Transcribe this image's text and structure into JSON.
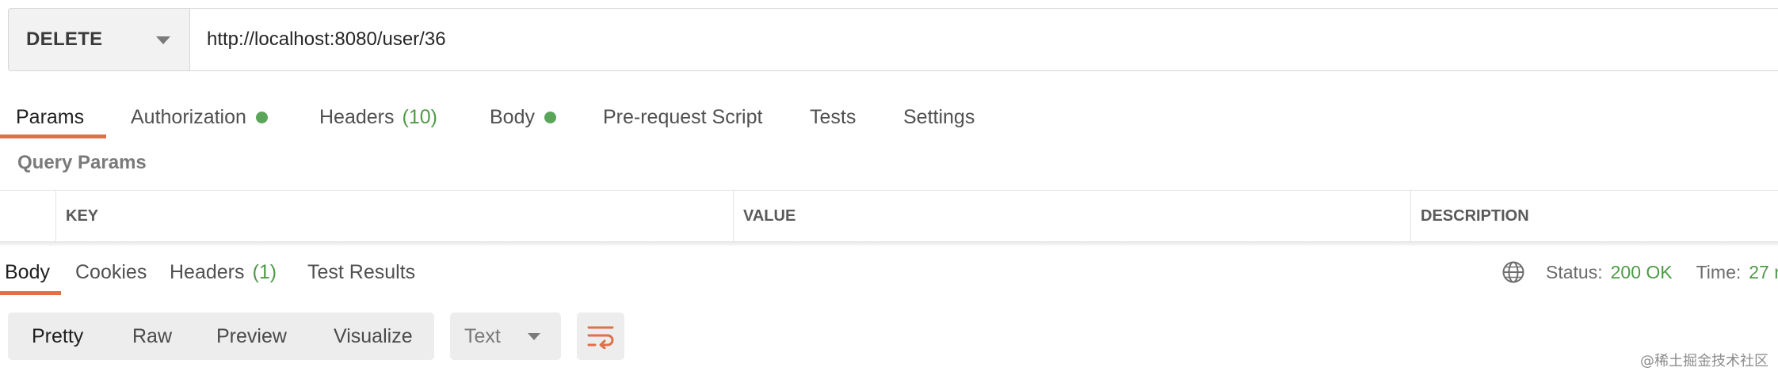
{
  "request": {
    "method": "DELETE",
    "url": "http://localhost:8080/user/36"
  },
  "request_tabs": [
    {
      "label": "Params",
      "active": true
    },
    {
      "label": "Authorization",
      "dot": true
    },
    {
      "label": "Headers",
      "count": "(10)"
    },
    {
      "label": "Body",
      "dot": true
    },
    {
      "label": "Pre-request Script"
    },
    {
      "label": "Tests"
    },
    {
      "label": "Settings"
    }
  ],
  "query_params": {
    "title": "Query Params",
    "columns": [
      "KEY",
      "VALUE",
      "DESCRIPTION"
    ]
  },
  "response_tabs": [
    {
      "label": "Body",
      "active": true
    },
    {
      "label": "Cookies"
    },
    {
      "label": "Headers",
      "count": "(1)"
    },
    {
      "label": "Test Results"
    }
  ],
  "response_status": {
    "status_label": "Status:",
    "status_value": "200 OK",
    "time_label": "Time:",
    "time_value": "27 r"
  },
  "view_modes": [
    "Pretty",
    "Raw",
    "Preview",
    "Visualize"
  ],
  "active_view_mode": "Pretty",
  "format": "Text",
  "watermark": "@稀土掘金技术社区",
  "colors": {
    "accent": "#e0704a",
    "green": "#4f9a47"
  },
  "icons": [
    "chevron-down-icon",
    "globe-icon",
    "wrap-lines-icon"
  ]
}
